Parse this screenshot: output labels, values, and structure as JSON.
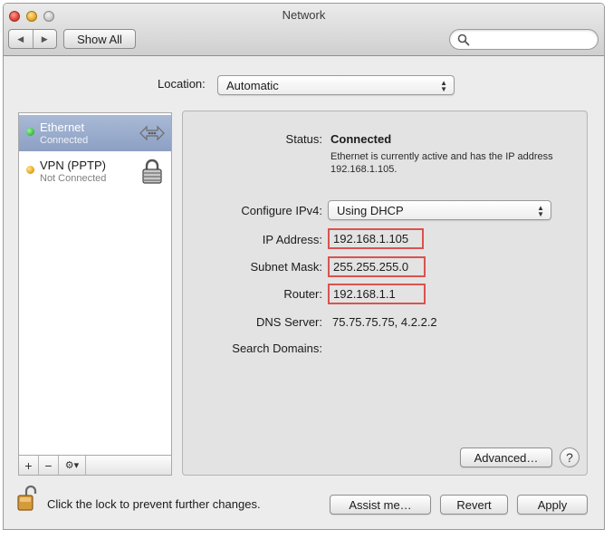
{
  "window": {
    "title": "Network",
    "show_all": "Show All",
    "search_placeholder": ""
  },
  "location": {
    "label": "Location:",
    "value": "Automatic"
  },
  "services": [
    {
      "name": "Ethernet",
      "status": "Connected",
      "dot_color": "#3ec446",
      "selected": true,
      "icon": "ethernet-arrows-icon"
    },
    {
      "name": "VPN (PPTP)",
      "status": "Not Connected",
      "dot_color": "#e9a81a",
      "selected": false,
      "icon": "vpn-lock-icon"
    }
  ],
  "sidebar_controls": {
    "add": "+",
    "remove": "−",
    "gear": "⚙▾"
  },
  "detail": {
    "status_label": "Status:",
    "status_value": "Connected",
    "status_desc": "Ethernet is currently active and has the IP address 192.168.1.105.",
    "configure_label": "Configure IPv4:",
    "configure_value": "Using DHCP",
    "ip_label": "IP Address:",
    "ip_value": "192.168.1.105",
    "subnet_label": "Subnet Mask:",
    "subnet_value": "255.255.255.0",
    "router_label": "Router:",
    "router_value": "192.168.1.1",
    "dns_label": "DNS Server:",
    "dns_value": "75.75.75.75, 4.2.2.2",
    "search_domains_label": "Search Domains:",
    "advanced": "Advanced…",
    "help": "?"
  },
  "footer": {
    "lock_text": "Click the lock to prevent further changes.",
    "assist": "Assist me…",
    "revert": "Revert",
    "apply": "Apply"
  },
  "colors": {
    "highlight_border": "#d9534f",
    "selection": "#8da0c3"
  }
}
